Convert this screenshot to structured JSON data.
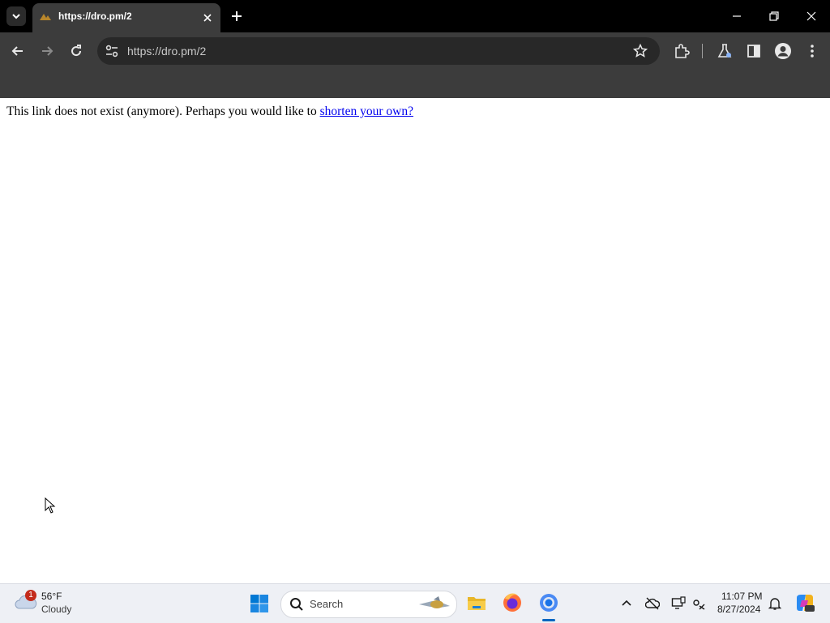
{
  "browser": {
    "tab_title": "https://dro.pm/2",
    "url": "https://dro.pm/2"
  },
  "page": {
    "message": "This link does not exist (anymore). Perhaps you would like to ",
    "link_text": "shorten your own?"
  },
  "taskbar": {
    "weather": {
      "temp": "56°F",
      "condition": "Cloudy",
      "badge": "1"
    },
    "search_label": "Search",
    "clock": {
      "time": "11:07 PM",
      "date": "8/27/2024"
    }
  },
  "colors": {
    "link": "#0000ee",
    "chrome_dark": "#3c3c3c",
    "taskbar_bg": "#eef0f5"
  }
}
